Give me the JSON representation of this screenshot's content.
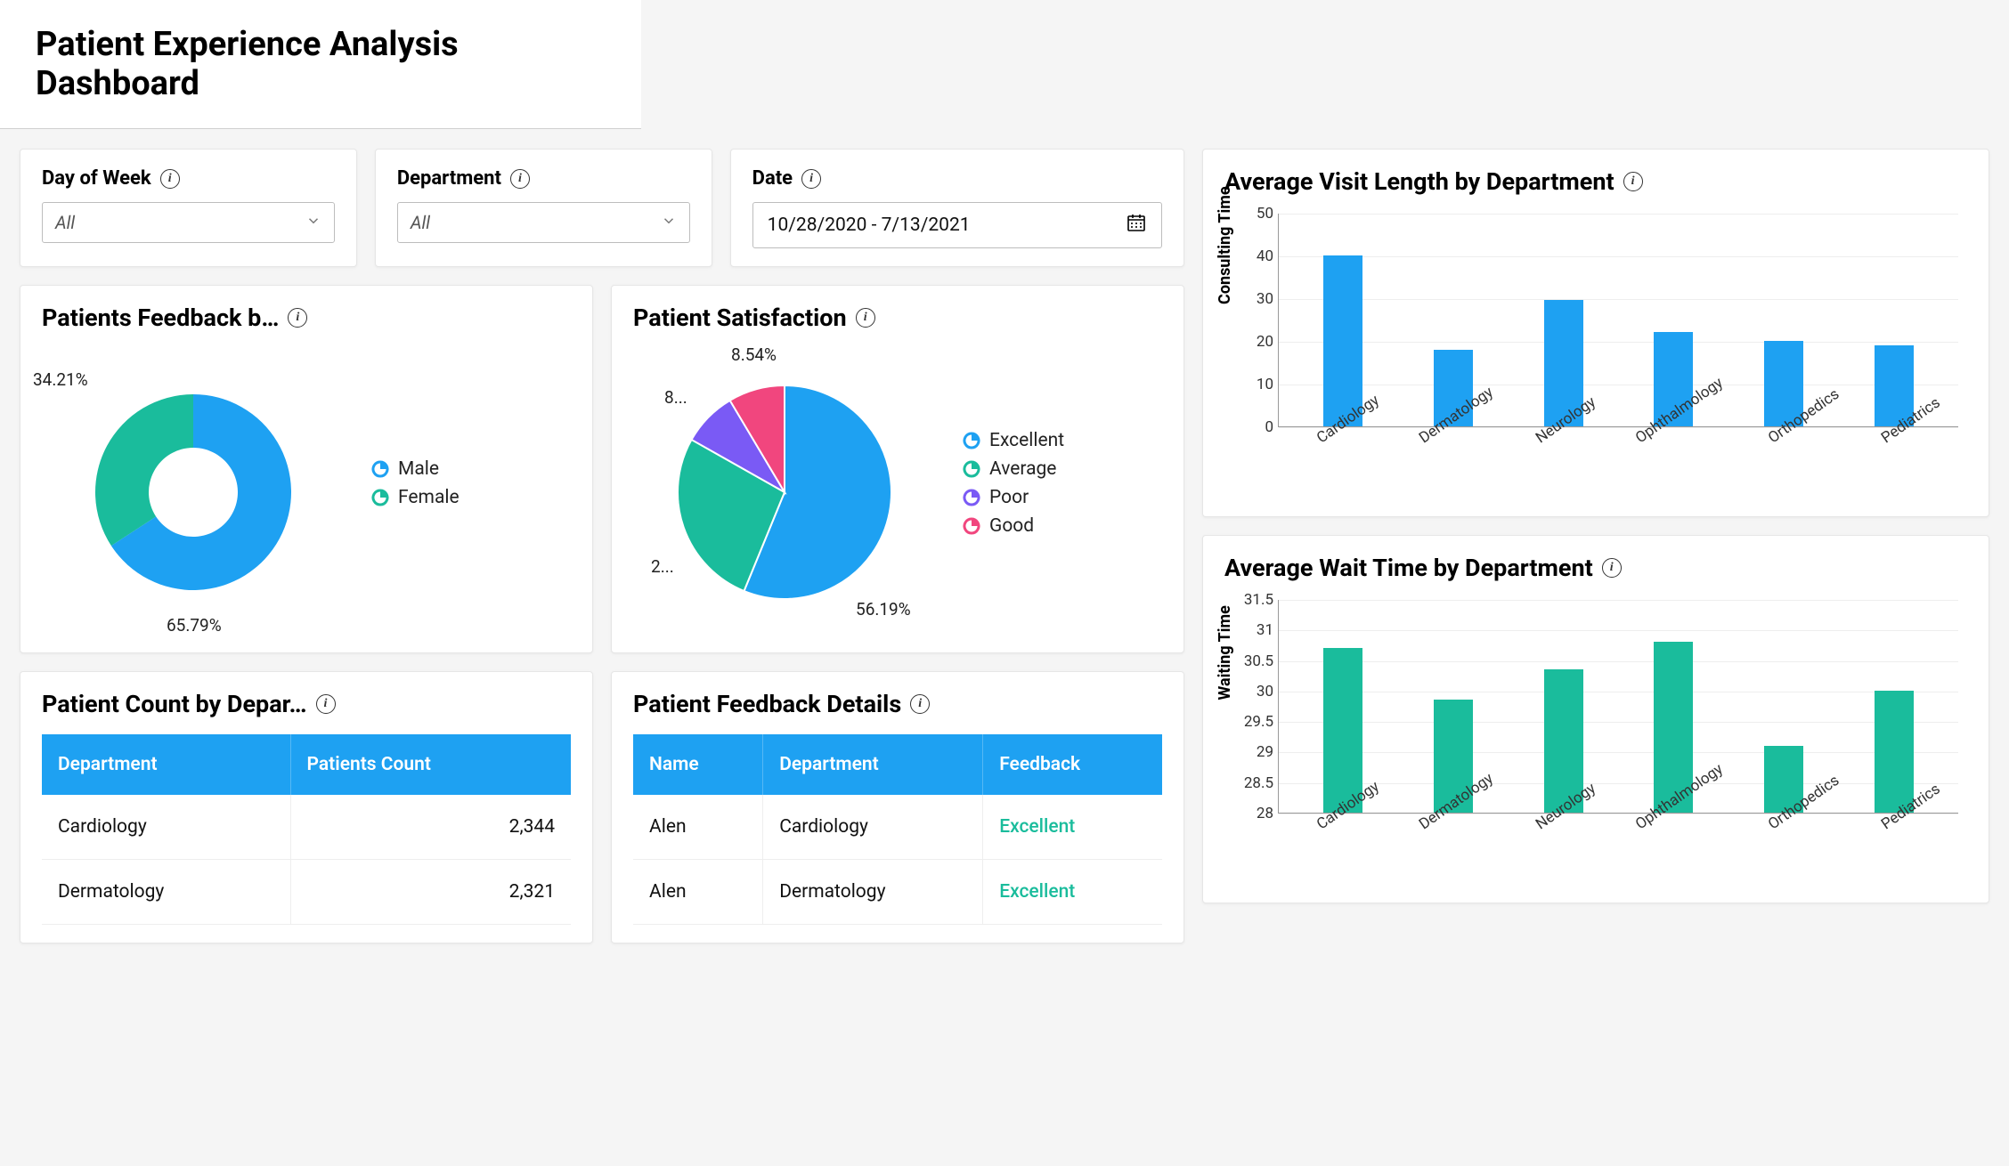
{
  "page_title": "Patient Experience Analysis Dashboard",
  "filters": {
    "day_of_week": {
      "label": "Day of Week",
      "value": "All"
    },
    "department": {
      "label": "Department",
      "value": "All"
    },
    "date": {
      "label": "Date",
      "value": "10/28/2020 - 7/13/2021"
    }
  },
  "cards": {
    "feedback_by_gender": {
      "title": "Patients Feedback b…",
      "legend": [
        "Male",
        "Female"
      ],
      "labels": {
        "male": "65.79%",
        "female": "34.21%"
      }
    },
    "satisfaction": {
      "title": "Patient Satisfaction",
      "legend": [
        "Excellent",
        "Average",
        "Poor",
        "Good"
      ],
      "labels": {
        "excellent": "56.19%",
        "average": "2...",
        "poor": "8...",
        "good": "8.54%"
      }
    },
    "count_by_dept": {
      "title": "Patient Count by Depar…",
      "columns": [
        "Department",
        "Patients Count"
      ],
      "rows": [
        {
          "dept": "Cardiology",
          "count": "2,344"
        },
        {
          "dept": "Dermatology",
          "count": "2,321"
        }
      ]
    },
    "feedback_details": {
      "title": "Patient Feedback Details",
      "columns": [
        "Name",
        "Department",
        "Feedback"
      ],
      "rows": [
        {
          "name": "Alen",
          "dept": "Cardiology",
          "fb": "Excellent"
        },
        {
          "name": "Alen",
          "dept": "Dermatology",
          "fb": "Excellent"
        }
      ]
    },
    "visit_length": {
      "title": "Average Visit Length by Department",
      "ylabel": "Consulting Time"
    },
    "wait_time": {
      "title": "Average Wait Time by Department",
      "ylabel": "Waiting Time"
    }
  },
  "colors": {
    "blue": "#1ea1f2",
    "teal": "#1abc9c",
    "purple": "#7a5af5",
    "pink": "#f1467e"
  },
  "chart_data": [
    {
      "id": "feedback_by_gender",
      "type": "pie",
      "title": "Patients Feedback by Gender",
      "series": [
        {
          "name": "Male",
          "value": 65.79,
          "color": "#1ea1f2"
        },
        {
          "name": "Female",
          "value": 34.21,
          "color": "#1abc9c"
        }
      ],
      "donut": true
    },
    {
      "id": "patient_satisfaction",
      "type": "pie",
      "title": "Patient Satisfaction",
      "series": [
        {
          "name": "Excellent",
          "value": 56.19,
          "color": "#1ea1f2"
        },
        {
          "name": "Average",
          "value": 27.0,
          "color": "#1abc9c"
        },
        {
          "name": "Poor",
          "value": 8.27,
          "color": "#7a5af5"
        },
        {
          "name": "Good",
          "value": 8.54,
          "color": "#f1467e"
        }
      ],
      "donut": false
    },
    {
      "id": "avg_visit_length_by_dept",
      "type": "bar",
      "title": "Average Visit Length by Department",
      "ylabel": "Consulting Time",
      "ylim": [
        0,
        50
      ],
      "yticks": [
        0,
        10,
        20,
        30,
        40,
        50
      ],
      "categories": [
        "Cardiology",
        "Dermatology",
        "Neurology",
        "Ophthalmology",
        "Orthopedics",
        "Pediatrics"
      ],
      "values": [
        40,
        18,
        29.5,
        22,
        20,
        19
      ],
      "color": "#1ea1f2"
    },
    {
      "id": "avg_wait_time_by_dept",
      "type": "bar",
      "title": "Average Wait Time by Department",
      "ylabel": "Waiting Time",
      "ylim": [
        28,
        31.5
      ],
      "yticks": [
        28,
        28.5,
        29,
        29.5,
        30,
        30.5,
        31,
        31.5
      ],
      "categories": [
        "Cardiology",
        "Dermatology",
        "Neurology",
        "Ophthalmology",
        "Orthopedics",
        "Pediatrics"
      ],
      "values": [
        30.7,
        29.85,
        30.35,
        30.8,
        29.1,
        30.0
      ],
      "color": "#1abc9c"
    }
  ]
}
